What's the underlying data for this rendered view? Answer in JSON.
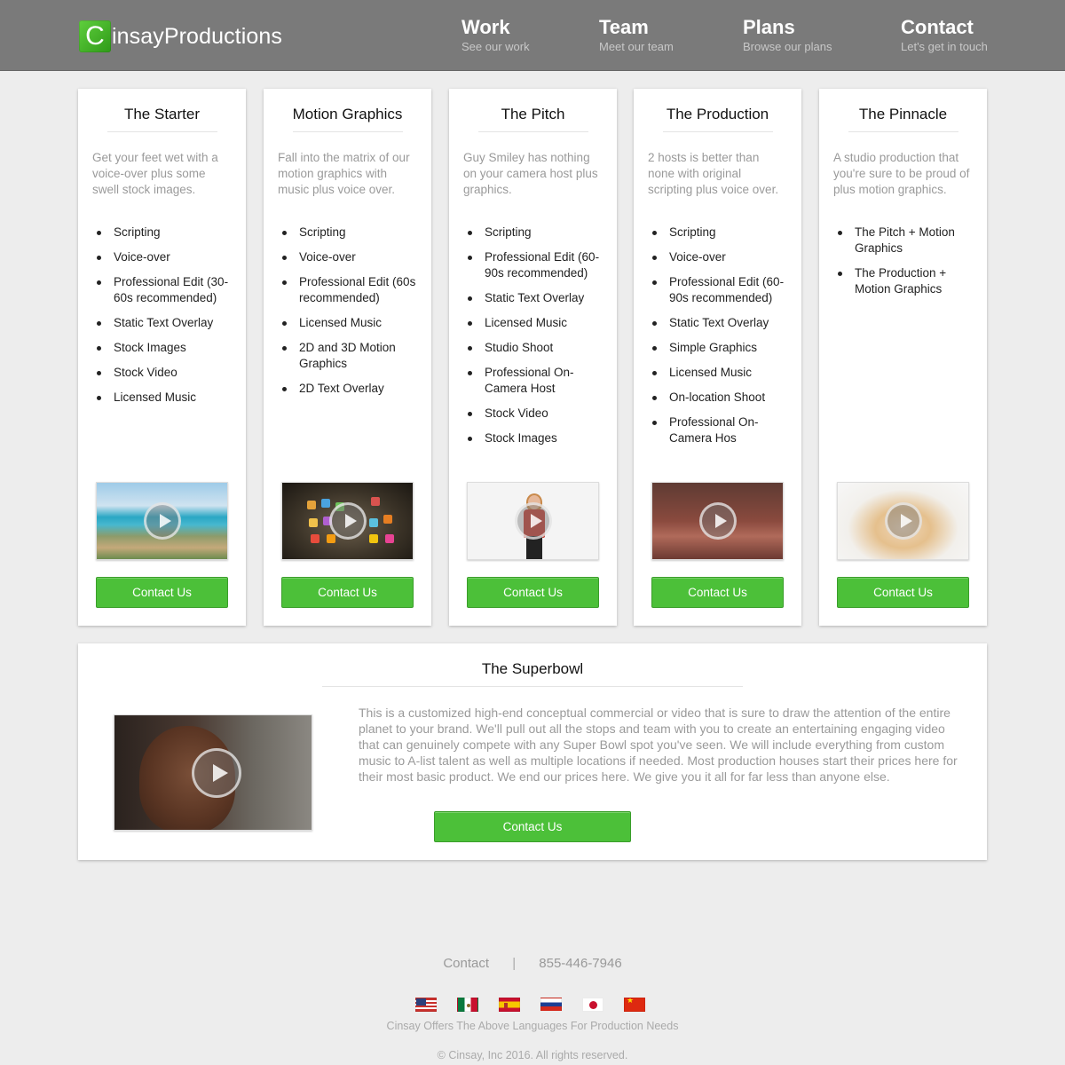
{
  "brand": {
    "logo_letter": "C",
    "name": "insayProductions"
  },
  "nav": [
    {
      "title": "Work",
      "subtitle": "See our work"
    },
    {
      "title": "Team",
      "subtitle": "Meet our team"
    },
    {
      "title": "Plans",
      "subtitle": "Browse our plans"
    },
    {
      "title": "Contact",
      "subtitle": "Let's get in touch"
    }
  ],
  "plans": [
    {
      "title": "The Starter",
      "description": "Get your feet wet with a voice-over plus some swell stock images.",
      "features": [
        "Scripting",
        "Voice-over",
        "Professional Edit (30-60s recommended)",
        "Static Text Overlay",
        "Stock Images",
        "Stock Video",
        "Licensed Music"
      ],
      "button": "Contact Us"
    },
    {
      "title": "Motion Graphics",
      "description": "Fall into the matrix of our motion graphics with music plus voice over.",
      "features": [
        "Scripting",
        "Voice-over",
        "Professional Edit (60s recommended)",
        "Licensed Music",
        "2D and 3D Motion Graphics",
        "2D Text Overlay"
      ],
      "button": "Contact Us"
    },
    {
      "title": "The Pitch",
      "description": "Guy Smiley has nothing on your camera host plus graphics.",
      "features": [
        "Scripting",
        "Professional Edit (60-90s recommended)",
        "Static Text Overlay",
        "Licensed Music",
        "Studio Shoot",
        "Professional On-Camera Host",
        "Stock Video",
        "Stock Images"
      ],
      "button": "Contact Us"
    },
    {
      "title": "The Production",
      "description": "2 hosts is better than none with original scripting plus voice over.",
      "features": [
        "Scripting",
        "Voice-over",
        "Professional Edit (60-90s recommended)",
        "Static Text Overlay",
        "Simple Graphics",
        "Licensed Music",
        "On-location Shoot",
        "Professional On-Camera Hos"
      ],
      "button": "Contact Us"
    },
    {
      "title": "The Pinnacle",
      "description": "A studio production that you're sure to be proud of plus motion graphics.",
      "features": [
        "The Pitch + Motion Graphics",
        "The Production + Motion Graphics"
      ],
      "button": "Contact Us"
    }
  ],
  "superbowl": {
    "title": "The Superbowl",
    "description": "This is a customized high-end conceptual commercial or video that is sure to draw the attention of the entire planet to your brand. We'll pull out all the stops and team with you to create an entertaining engaging video that can genuinely compete with any Super Bowl spot you've seen. We will include everything from custom music to A-list talent as well as multiple locations if needed. Most production houses start their prices here for their most basic product. We end our prices here. We give you it all for far less than anyone else.",
    "button": "Contact Us"
  },
  "footer": {
    "contact_label": "Contact",
    "separator": "|",
    "phone": "855-446-7946",
    "flags": [
      "us-flag-icon",
      "mexico-flag-icon",
      "spain-flag-icon",
      "russia-flag-icon",
      "japan-flag-icon",
      "china-flag-icon"
    ],
    "languages_note": "Cinsay Offers The Above Languages For Production Needs",
    "copyright": "© Cinsay, Inc 2016. All rights reserved."
  },
  "colors": {
    "header_bg": "#7a7a7a",
    "button_green": "#4cc039",
    "page_bg": "#ededed"
  }
}
